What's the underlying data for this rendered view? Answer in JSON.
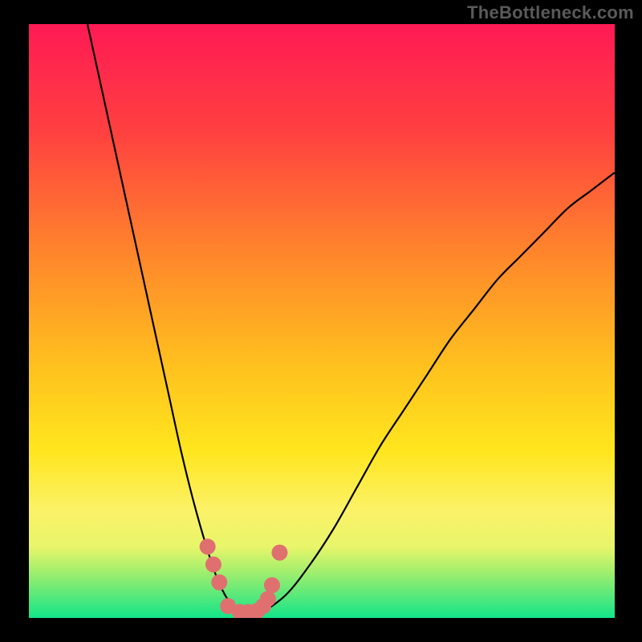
{
  "watermark": "TheBottleneck.com",
  "chart_data": {
    "type": "line",
    "title": "",
    "xlabel": "",
    "ylabel": "",
    "xlim": [
      0,
      100
    ],
    "ylim": [
      0,
      100
    ],
    "series": [
      {
        "name": "bottleneck-curve",
        "x": [
          10,
          12,
          14,
          16,
          18,
          20,
          22,
          24,
          26,
          28,
          30,
          32,
          34,
          36,
          38,
          40,
          44,
          48,
          52,
          56,
          60,
          64,
          68,
          72,
          76,
          80,
          84,
          88,
          92,
          96,
          100
        ],
        "y": [
          100,
          91,
          82,
          73,
          64,
          55,
          46,
          37,
          28,
          20,
          13,
          7,
          3,
          1,
          0,
          1,
          4,
          9,
          15,
          22,
          29,
          35,
          41,
          47,
          52,
          57,
          61,
          65,
          69,
          72,
          75
        ]
      }
    ],
    "markers": {
      "name": "highlight-points",
      "x": [
        30.5,
        31.5,
        32.5,
        34,
        36,
        37.5,
        39,
        40,
        40.8,
        41.5,
        42.8
      ],
      "y": [
        12,
        9,
        6,
        2,
        1,
        1,
        1.2,
        2,
        3.2,
        5.5,
        11
      ]
    },
    "background_bands": [
      {
        "y0": 0,
        "y1": 3,
        "color": "#12e58a"
      },
      {
        "y0": 3,
        "y1": 5,
        "color": "#5de97a"
      },
      {
        "y0": 5,
        "y1": 8,
        "color": "#a6ef6d"
      },
      {
        "y0": 8,
        "y1": 12,
        "color": "#e8f56a"
      },
      {
        "y0": 12,
        "y1": 18,
        "color": "#fbf268"
      }
    ],
    "gradient_stops": [
      {
        "offset": 0,
        "color": "#ff1a55"
      },
      {
        "offset": 18,
        "color": "#ff4040"
      },
      {
        "offset": 40,
        "color": "#ff8a2a"
      },
      {
        "offset": 58,
        "color": "#ffc21e"
      },
      {
        "offset": 72,
        "color": "#ffe61e"
      },
      {
        "offset": 82,
        "color": "#fbf268"
      },
      {
        "offset": 88,
        "color": "#e8f56a"
      },
      {
        "offset": 92,
        "color": "#a6ef6d"
      },
      {
        "offset": 96,
        "color": "#5de97a"
      },
      {
        "offset": 100,
        "color": "#12e58a"
      }
    ]
  }
}
